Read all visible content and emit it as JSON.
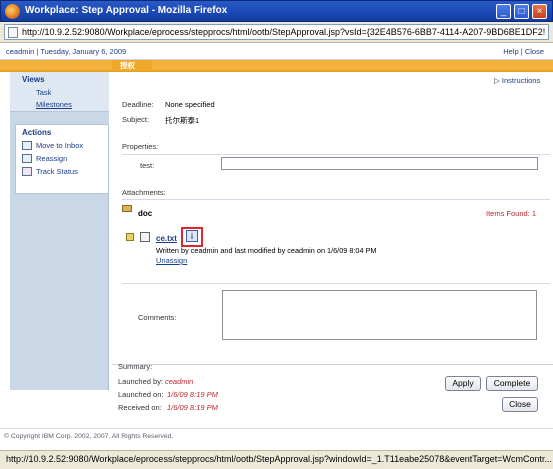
{
  "window": {
    "title": "Workplace: Step Approval - Mozilla Firefox",
    "minimize": "_",
    "maximize": "□",
    "close": "×"
  },
  "address_bar": {
    "url": "http://10.9.2.52:9080/Workplace/eprocess/stepprocs/html/ootb/StepApproval.jsp?vsId={32E4B576-6BB7-4114-A207-9BD6BE1DF2!"
  },
  "header": {
    "user_date": "ceadmin | Tuesday, January 6, 2009",
    "help": "Help",
    "separator": "|",
    "close": "Close"
  },
  "tab_bar": {
    "active_tab": "授权"
  },
  "sidebar": {
    "views_title": "Views",
    "views": [
      "Task",
      "Milestones"
    ],
    "actions_title": "Actions",
    "actions": [
      "Move to Inbox",
      "Reassign",
      "Track Status"
    ]
  },
  "instructions": "Instructions",
  "details": {
    "deadline_label": "Deadline:",
    "deadline_value": "None specified",
    "subject_label": "Subject:",
    "subject_value": "托尔斯泰1"
  },
  "properties": {
    "title": "Properties:",
    "test_label": "test:",
    "test_value": ""
  },
  "attachments": {
    "title": "Attachments:",
    "folder_name": "doc",
    "items_found": "Items Found: 1",
    "file_name": "ce.txt",
    "file_meta": "Written by ceadmin and last modified by ceadmin on 1/6/09 8:04 PM",
    "unassign": "Unassign"
  },
  "comments": {
    "label": "Comments:",
    "value": ""
  },
  "summary": {
    "title": "Summary:",
    "launched_by_label": "Launched by:",
    "launched_by_value": "ceadmin",
    "launched_on_label": "Launched on:",
    "launched_on_value": "1/6/09 8:19 PM",
    "received_on_label": "Received on:",
    "received_on_value": "1/6/09 8:19 PM"
  },
  "buttons": {
    "apply": "Apply",
    "complete": "Complete",
    "close": "Close"
  },
  "footer": {
    "copyright": "© Copyright IBM Corp. 2002, 2007. All Rights Reserved."
  },
  "status_bar": {
    "text": "http://10.9.2.52:9080/Workplace/eprocess/stepprocs/html/ootb/StepApproval.jsp?windowId=_1.T11eabe25078&eventTarget=WcmContr..."
  },
  "colors": {
    "titlebar": "#1947b3",
    "accent_orange": "#f4b23c",
    "link_blue": "#173e87",
    "alert_red": "#c0262e"
  }
}
